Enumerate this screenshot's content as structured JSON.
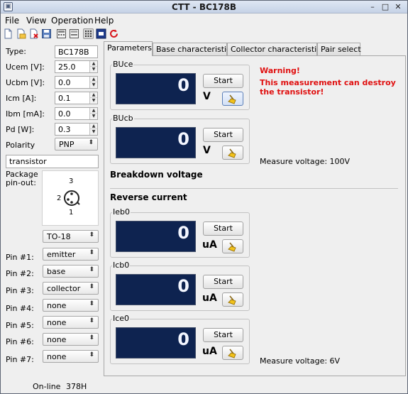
{
  "window": {
    "title": "CTT - BC178B"
  },
  "menu": [
    {
      "label": "File"
    },
    {
      "label": "View"
    },
    {
      "label": "Operation"
    },
    {
      "label": "Help"
    }
  ],
  "toolbar": [
    {
      "name": "new-document-icon"
    },
    {
      "name": "open-file-icon"
    },
    {
      "name": "close-file-icon"
    },
    {
      "name": "save-icon"
    },
    {
      "name": "calculator-icon"
    },
    {
      "name": "calculator-alt-icon"
    },
    {
      "name": "grid-icon"
    },
    {
      "name": "chip-icon"
    },
    {
      "name": "refresh-icon"
    }
  ],
  "params": {
    "type_label": "Type:",
    "type_value": "BC178B",
    "ucem_label": "Ucem [V]:",
    "ucem_value": "25.0",
    "ucbm_label": "Ucbm [V]:",
    "ucbm_value": "0.0",
    "icm_label": "Icm [A]:",
    "icm_value": "0.1",
    "ibm_label": "Ibm [mA]:",
    "ibm_value": "0.0",
    "pd_label": "Pd [W]:",
    "pd_value": "0.3",
    "polarity_label": "Polarity",
    "polarity_value": "PNP",
    "component_value": "transistor",
    "package_label_1": "Package",
    "package_label_2": "pin-out:",
    "package_value": "TO-18"
  },
  "pinout": {
    "pin1": "1",
    "pin2": "2",
    "pin3": "3"
  },
  "pins": [
    {
      "label": "Pin #1:",
      "value": "emitter"
    },
    {
      "label": "Pin #2:",
      "value": "base"
    },
    {
      "label": "Pin #3:",
      "value": "collector"
    },
    {
      "label": "Pin #4:",
      "value": "none"
    },
    {
      "label": "Pin #5:",
      "value": "none"
    },
    {
      "label": "Pin #6:",
      "value": "none"
    },
    {
      "label": "Pin #7:",
      "value": "none"
    }
  ],
  "tabs": [
    {
      "label": "Parameters",
      "active": true
    },
    {
      "label": "Base characteristic"
    },
    {
      "label": "Collector characteristic"
    },
    {
      "label": "Pair select"
    }
  ],
  "breakdown": {
    "section_title": "Breakdown voltage",
    "buce": {
      "title": "BUce",
      "value": "0",
      "unit": "V",
      "start": "Start"
    },
    "bucb": {
      "title": "BUcb",
      "value": "0",
      "unit": "V",
      "start": "Start"
    },
    "warning_1": "Warning!",
    "warning_2": "This measurement can destroy",
    "warning_3": "the transistor!",
    "measure_voltage": "Measure voltage: 100V"
  },
  "reverse": {
    "section_title": "Reverse current",
    "ieb0": {
      "title": "Ieb0",
      "value": "0",
      "unit": "uA",
      "start": "Start"
    },
    "icb0": {
      "title": "Icb0",
      "value": "0",
      "unit": "uA",
      "start": "Start"
    },
    "ice0": {
      "title": "Ice0",
      "value": "0",
      "unit": "uA",
      "start": "Start"
    },
    "measure_voltage": "Measure voltage: 6V"
  },
  "status": {
    "connection": "On-line",
    "code": "378H"
  },
  "colors": {
    "lcd_bg": "#0e2350",
    "warning": "#e01010",
    "titlebar": "#c5d2e6"
  }
}
